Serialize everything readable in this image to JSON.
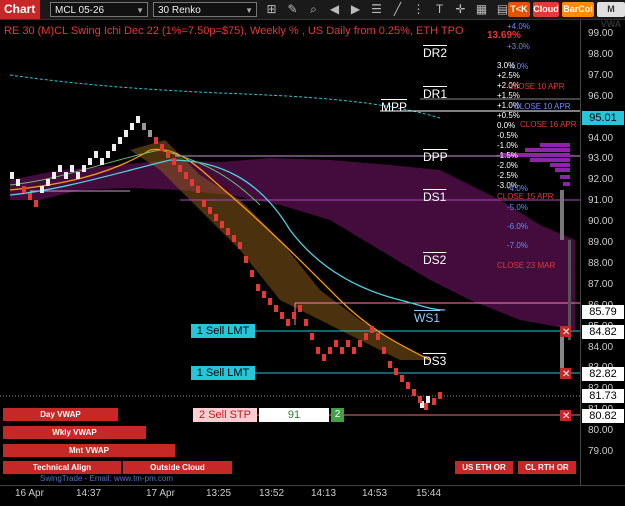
{
  "toolbar": {
    "chart_label": "Chart",
    "symbol": "MCL 05-26",
    "period": "30 Renko",
    "btn_tk": "T<K",
    "btn_cloud": "Cloud",
    "btn_barcol": "BarCol",
    "btn_m": "M VWA"
  },
  "title": "RE 30 (M)CL Swing Ichi Dec 22  (1%=7.50p=$75), Weekly % , US Daily from 0.25%, ETH TPO",
  "overlay_red": "13.69%",
  "price_axis": [
    "99.00",
    "98.00",
    "97.00",
    "96.00",
    "95.00",
    "94.00",
    "93.00",
    "92.00",
    "91.00",
    "90.00",
    "89.00",
    "88.00",
    "87.00",
    "86.00",
    "85.00",
    "84.00",
    "83.00",
    "82.00",
    "81.00",
    "80.00",
    "79.00"
  ],
  "price_tags": [
    {
      "value": "95.01",
      "color": "#26c6da"
    },
    {
      "value": "85.79",
      "color": "#ffffff"
    },
    {
      "value": "84.82",
      "color": "#ffffff"
    },
    {
      "value": "82.82",
      "color": "#ffffff"
    },
    {
      "value": "81.73",
      "color": "#ffffff"
    },
    {
      "value": "80.82",
      "color": "#ffffff"
    }
  ],
  "levels": {
    "dr2": "DR2",
    "dr1": "DR1",
    "mpp": "MPP",
    "dpp": "DPP",
    "ds1": "DS1",
    "ds2": "DS2",
    "ws1": "WS1",
    "ds3": "DS3"
  },
  "pct_top": [
    "+4.0%",
    "+3.0%",
    "4.0%"
  ],
  "pct_white": [
    "3.0%",
    "+2.5%",
    "+2.0%",
    "+1.5%",
    "+1.0%",
    "+0.5%",
    "0.0%",
    "-0.5%",
    "-1.0%",
    "-1.5%",
    "-2.0%",
    "-2.5%",
    "-3.0%"
  ],
  "pct_blue": [
    "-4.0%",
    "-5.0%",
    "-6.0%",
    "-7.0%"
  ],
  "close_labels": [
    "CLOSE 10 APR",
    "CLOSE 10 APR",
    "CLOSE 16 APR",
    "CLOSE 15 APR",
    "CLOSE 23 MAR"
  ],
  "orders": {
    "sell_lmt_1": "1 Sell LMT",
    "sell_lmt_2": "1 Sell LMT",
    "sell_stp": "2 Sell STP",
    "qty": "91",
    "count": "2"
  },
  "buttons": {
    "day_vwap": "Day VWAP",
    "wkly_vwap": "Wkly VWAP",
    "mnt_vwap": "Mnt VWAP",
    "technical_align": "Technical Align",
    "outside_cloud": "Outside Cloud",
    "us_eth_or": "US ETH OR",
    "cl_rth_or": "CL RTH OR"
  },
  "watermark": "SwingTrade - Email: www.tm-pm.com",
  "x_axis": [
    "16 Apr",
    "14:37",
    "17 Apr",
    "13:25",
    "13:52",
    "14:13",
    "14:53",
    "15:44"
  ]
}
